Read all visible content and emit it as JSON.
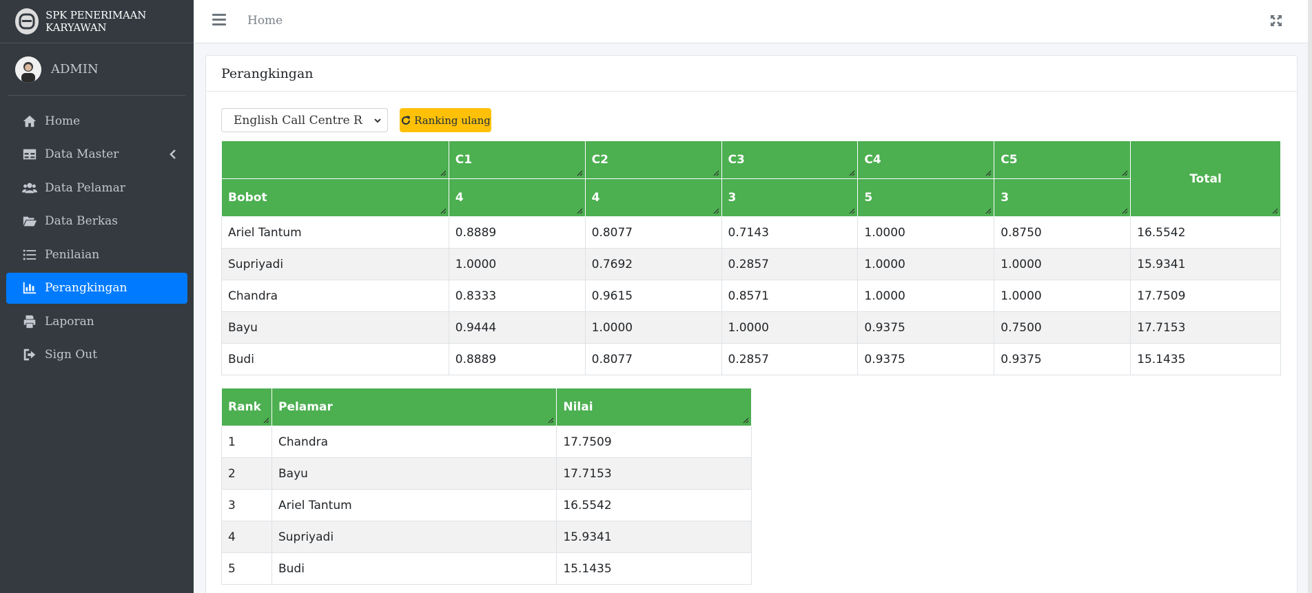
{
  "brand": {
    "title": "SPK PENERIMAAN KARYAWAN"
  },
  "user": {
    "name": "ADMIN"
  },
  "sidebar": {
    "items": [
      {
        "label": "Home",
        "icon": "home-icon"
      },
      {
        "label": "Data Master",
        "icon": "table-icon"
      },
      {
        "label": "Data Pelamar",
        "icon": "users-icon"
      },
      {
        "label": "Data Berkas",
        "icon": "folder-open-icon"
      },
      {
        "label": "Penilaian",
        "icon": "list-icon"
      },
      {
        "label": "Perangkingan",
        "icon": "bar-chart-icon",
        "active": true
      },
      {
        "label": "Laporan",
        "icon": "print-icon"
      },
      {
        "label": "Sign Out",
        "icon": "sign-out-icon"
      }
    ]
  },
  "topbar": {
    "breadcrumb": "Home"
  },
  "card": {
    "title": "Perangkingan"
  },
  "controls": {
    "selected_position": "English Call Centre Representative",
    "rank_button": "Ranking ulang"
  },
  "criteria_table": {
    "criteria": [
      "C1",
      "C2",
      "C3",
      "C4",
      "C5"
    ],
    "weight_label": "Bobot",
    "weights": [
      "4",
      "4",
      "3",
      "5",
      "3"
    ],
    "total_label": "Total",
    "rows": [
      {
        "name": "Ariel Tantum",
        "values": [
          "0.8889",
          "0.8077",
          "0.7143",
          "1.0000",
          "0.8750"
        ],
        "total": "16.5542"
      },
      {
        "name": "Supriyadi",
        "values": [
          "1.0000",
          "0.7692",
          "0.2857",
          "1.0000",
          "1.0000"
        ],
        "total": "15.9341"
      },
      {
        "name": "Chandra",
        "values": [
          "0.8333",
          "0.9615",
          "0.8571",
          "1.0000",
          "1.0000"
        ],
        "total": "17.7509"
      },
      {
        "name": "Bayu",
        "values": [
          "0.9444",
          "1.0000",
          "1.0000",
          "0.9375",
          "0.7500"
        ],
        "total": "17.7153"
      },
      {
        "name": "Budi",
        "values": [
          "0.8889",
          "0.8077",
          "0.2857",
          "0.9375",
          "0.9375"
        ],
        "total": "15.1435"
      }
    ]
  },
  "rank_table": {
    "headers": [
      "Rank",
      "Pelamar",
      "Nilai"
    ],
    "rows": [
      {
        "rank": "1",
        "name": "Chandra",
        "score": "17.7509"
      },
      {
        "rank": "2",
        "name": "Bayu",
        "score": "17.7153"
      },
      {
        "rank": "3",
        "name": "Ariel Tantum",
        "score": "16.5542"
      },
      {
        "rank": "4",
        "name": "Supriyadi",
        "score": "15.9341"
      },
      {
        "rank": "5",
        "name": "Budi",
        "score": "15.1435"
      }
    ]
  },
  "colors": {
    "sidebar": "#343a40",
    "active": "#007bff",
    "table_header": "#4caf50",
    "button": "#ffc107"
  }
}
